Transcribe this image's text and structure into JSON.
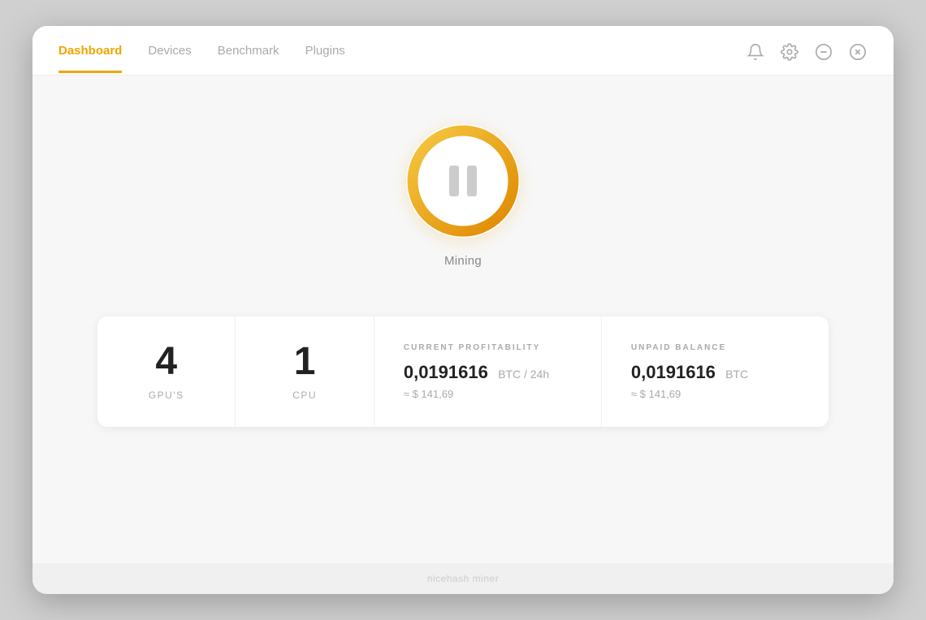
{
  "nav": {
    "items": [
      {
        "id": "dashboard",
        "label": "Dashboard",
        "active": true
      },
      {
        "id": "devices",
        "label": "Devices",
        "active": false
      },
      {
        "id": "benchmark",
        "label": "Benchmark",
        "active": false
      },
      {
        "id": "plugins",
        "label": "Plugins",
        "active": false
      }
    ]
  },
  "icons": {
    "bell": "🔔",
    "settings": "⚙",
    "minimize": "⊖",
    "close": "⊗"
  },
  "mining": {
    "status_label": "Mining",
    "button_title": "Pause Mining"
  },
  "stats": {
    "gpu_count": "4",
    "gpu_label": "GPU'S",
    "cpu_count": "1",
    "cpu_label": "CPU",
    "profitability": {
      "section_label": "CURRENT PROFITABILITY",
      "btc_value": "0,0191616",
      "btc_unit": "BTC / 24h",
      "usd_approx": "≈ $ 141,69"
    },
    "balance": {
      "section_label": "UNPAID BALANCE",
      "btc_value": "0,0191616",
      "btc_unit": "BTC",
      "usd_approx": "≈ $ 141,69"
    }
  },
  "bottom": {
    "hint_text": "nicehash miner"
  },
  "colors": {
    "accent": "#f0a500",
    "text_primary": "#222222",
    "text_muted": "#aaaaaa"
  }
}
